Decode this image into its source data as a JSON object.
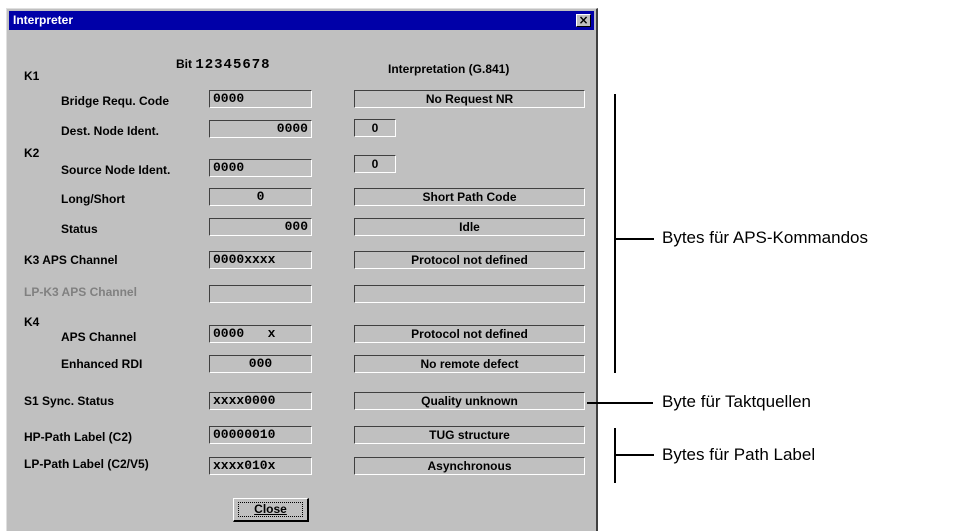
{
  "window": {
    "title": "Interpreter",
    "close_glyph": "×"
  },
  "header": {
    "bit_label": "Bit",
    "bit_digits": "12345678",
    "interpretation_label": "Interpretation (G.841)"
  },
  "groups": {
    "k1": "K1",
    "k2": "K2",
    "k3": "K3 APS Channel",
    "lpk3": "LP-K3 APS Channel",
    "k4": "K4",
    "s1": "S1 Sync. Status",
    "hp": "HP-Path Label (C2)",
    "lp": "LP-Path Label (C2/V5)"
  },
  "rows": {
    "bridge": {
      "label": "Bridge Requ. Code",
      "bits": "0000",
      "interp": "No Request NR"
    },
    "dest": {
      "label": "Dest. Node Ident.",
      "bits": "0000",
      "interp": "0"
    },
    "source": {
      "label": "Source Node Ident.",
      "bits": "0000",
      "interp": "0"
    },
    "longshort": {
      "label": "Long/Short",
      "bits": "0",
      "interp": "Short Path Code"
    },
    "status": {
      "label": "Status",
      "bits": "000",
      "interp": "Idle"
    },
    "k3": {
      "bits": "0000xxxx",
      "interp": "Protocol not defined"
    },
    "lpk3": {
      "bits": "",
      "interp": ""
    },
    "apsch": {
      "label": "APS Channel",
      "bits": "0000   x",
      "interp": "Protocol not defined"
    },
    "rdi": {
      "label": "Enhanced RDI",
      "bits": "000",
      "interp": "No remote defect"
    },
    "s1": {
      "bits": "xxxx0000",
      "interp": "Quality unknown"
    },
    "hp": {
      "bits": "00000010",
      "interp": "TUG structure"
    },
    "lp": {
      "bits": "xxxx010x",
      "interp": "Asynchronous"
    }
  },
  "buttons": {
    "close": "Close"
  },
  "annotations": {
    "aps": "Bytes für APS-Kommandos",
    "sync": "Byte für Taktquellen",
    "path": "Bytes für Path Label"
  }
}
